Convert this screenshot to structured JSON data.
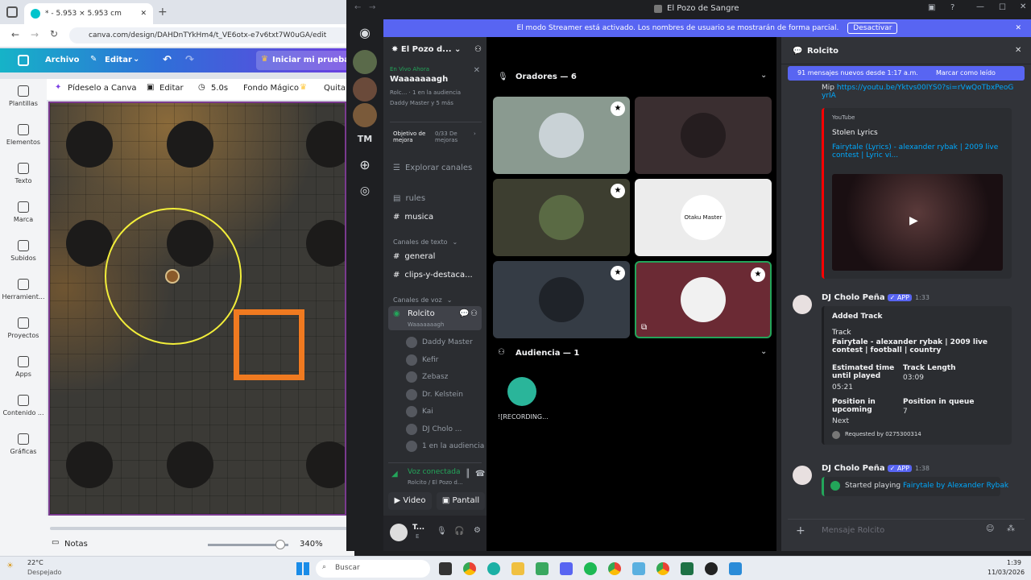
{
  "browser": {
    "tab_title": "* - 5.953 × 5.953 cm",
    "url": "canva.com/design/DAHDnTYkHm4/t_VE6otx-e7v6txt7W0uGA/edit"
  },
  "canva": {
    "header": {
      "archivo": "Archivo",
      "editar": "Editar",
      "trial": "Iniciar mi prueba g"
    },
    "toolbar": {
      "pideselo": "Pídeselo a Canva",
      "editar": "Editar",
      "time": "5.0s",
      "fondo": "Fondo Mágico",
      "quitar": "Quita"
    },
    "sidebar": [
      "Plantillas",
      "Elementos",
      "Texto",
      "Marca",
      "Subidos",
      "Herramient...",
      "Proyectos",
      "Apps",
      "Contenido ...",
      "Gráficas"
    ],
    "bottom": {
      "notas": "Notas",
      "zoom": "340%"
    }
  },
  "discord": {
    "window_title": "El Pozo de Sangre",
    "banner": {
      "text": "El modo Streamer está activado. Los nombres de usuario se mostrarán de forma parcial.",
      "button": "Desactivar"
    },
    "server": {
      "name": "El Pozo d...",
      "live_label": "En Vivo Ahora",
      "event_title": "Waaaaaaagh",
      "event_sub1": "Rolc...",
      "event_sub1b": "1 en la audiencia",
      "event_sub2": "Daddy Master y 5 más",
      "boost_title": "Objetivo de mejora",
      "boost_value": "0/33 De mejoras"
    },
    "server_icons": [
      "TM"
    ],
    "channels": {
      "explore": "Explorar canales",
      "rules": "rules",
      "musica": "musica",
      "text_cat": "Canales de texto",
      "general": "general",
      "clips": "clips-y-destaca...",
      "voice_cat": "Canales de voz",
      "voice_channel": "Rolcito",
      "voice_event": "Waaaaaaagh",
      "voice_users": [
        "Daddy Master",
        "Kefir",
        "Zebasz",
        "Dr. Kelstein",
        "Kai",
        "DJ Cholo ...",
        "1 en la audiencia"
      ]
    },
    "voice_panel": {
      "status": "Voz conectada",
      "location": "Rolcito / El Pozo d...",
      "video": "Video",
      "screen": "Pantall"
    },
    "user": {
      "name": "T...",
      "status": "E"
    },
    "stage": {
      "speakers_title": "Oradores — 6",
      "audience_title": "Audiencia — 1",
      "audience_member": "![RECORDING...",
      "tile_text": "Otaku Master"
    },
    "chat": {
      "channel": "Rolcito",
      "new_bar": "91 mensajes nuevos desde 1:17 a.m.",
      "mark_read": "Marcar como leído",
      "partial_prefix": "Mip",
      "partial_link": "https://youtu.be/Yktvs00IYS0?si=rVwQoTbxPeoGyrIA",
      "yt_provider": "YouTube",
      "yt_author": "Stolen Lyrics",
      "yt_title": "Fairytale (Lyrics) - alexander rybak | 2009 live contest | Lyric vi...",
      "bot_name": "DJ Cholo Peña",
      "app_badge": "✓ APP",
      "msg1_time": "1:33",
      "msg1": {
        "heading": "Added Track",
        "track_label": "Track",
        "track_value": "Fairytale - alexander rybak | 2009 live contest | football | country",
        "eta_label": "Estimated time until played",
        "eta_value": "05:21",
        "length_label": "Track Length",
        "length_value": "03:09",
        "pos_up_label": "Position in upcoming",
        "pos_up_value": "Next",
        "pos_q_label": "Position in queue",
        "pos_q_value": "7",
        "requested": "Requested by 0275300314"
      },
      "msg2_time": "1:38",
      "msg2": {
        "prefix": "Started playing",
        "link": "Fairytale by Alexander Rybak"
      },
      "input_placeholder": "Mensaje Rolcito"
    }
  },
  "taskbar": {
    "weather_temp": "22°C",
    "weather_desc": "Despejado",
    "search": "Buscar",
    "time": "1:39",
    "date": "11/03/2026"
  },
  "colors": {
    "blurple": "#5865f2",
    "canva_teal": "#00c4cc",
    "green": "#23a55a",
    "speaker_border": "#23a55a"
  }
}
